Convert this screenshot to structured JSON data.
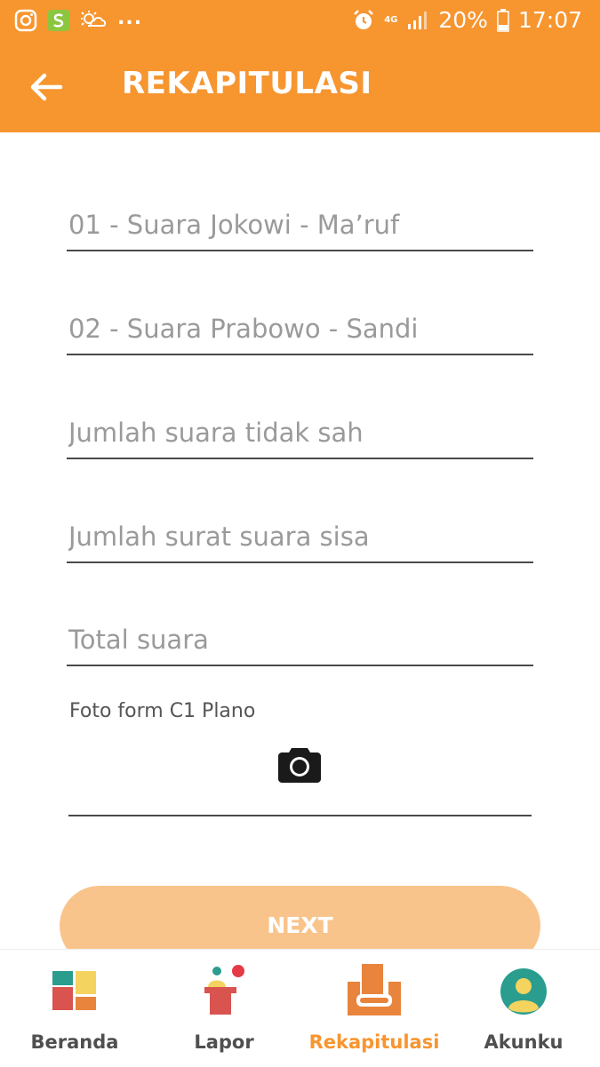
{
  "status_bar": {
    "more": "...",
    "network": "4G",
    "battery": "20%",
    "time": "17:07"
  },
  "app_bar": {
    "title": "REKAPITULASI"
  },
  "form": {
    "field1_placeholder": "01 - Suara Jokowi - Ma’ruf",
    "field2_placeholder": "02 - Suara Prabowo - Sandi",
    "field3_placeholder": "Jumlah suara tidak sah",
    "field4_placeholder": "Jumlah surat suara sisa",
    "field5_placeholder": "Total suara",
    "photo_label": "Foto form C1 Plano",
    "next_label": "NEXT"
  },
  "bottom_nav": {
    "items": [
      {
        "label": "Beranda",
        "icon": "home-tiles-icon"
      },
      {
        "label": "Lapor",
        "icon": "podium-icon"
      },
      {
        "label": "Rekapitulasi",
        "icon": "ballot-box-icon",
        "active": true
      },
      {
        "label": "Akunku",
        "icon": "user-avatar-icon"
      }
    ]
  },
  "colors": {
    "primary": "#f7952f",
    "button": "#f9c48b",
    "text_muted": "#9a9a9a"
  }
}
